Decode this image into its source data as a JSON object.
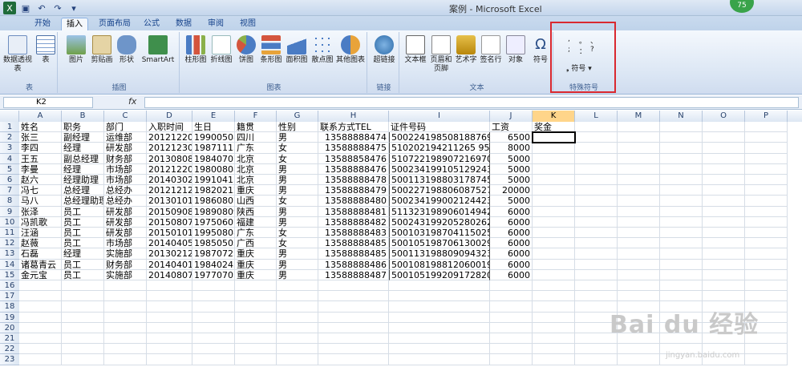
{
  "window": {
    "title": "案例 - Microsoft Excel",
    "badge": "75"
  },
  "qat": {
    "icons": [
      "excel-logo-icon",
      "save-icon",
      "undo-icon",
      "redo-icon",
      "customize-icon"
    ]
  },
  "tabs": [
    "开始",
    "插入",
    "页面布局",
    "公式",
    "数据",
    "审阅",
    "视图"
  ],
  "active_tab": "插入",
  "ribbon": {
    "groups": [
      {
        "label": "表",
        "buttons": [
          "数据透视表",
          "表"
        ]
      },
      {
        "label": "插图",
        "buttons": [
          "图片",
          "剪贴画",
          "形状",
          "SmartArt"
        ]
      },
      {
        "label": "图表",
        "buttons": [
          "柱形图",
          "折线图",
          "饼图",
          "条形图",
          "面积图",
          "散点图",
          "其他图表"
        ]
      },
      {
        "label": "链接",
        "buttons": [
          "超链接"
        ]
      },
      {
        "label": "文本",
        "buttons": [
          "文本框",
          "页眉和页脚",
          "艺术字",
          "签名行",
          "对象",
          "符号"
        ]
      },
      {
        "label": "特殊符号",
        "buttons": [
          "符号"
        ]
      }
    ],
    "special_symbols": [
      ",",
      "。",
      "、",
      ";",
      "：",
      "?"
    ]
  },
  "namebox": "K2",
  "fx_label": "fx",
  "columns": [
    "A",
    "B",
    "C",
    "D",
    "E",
    "F",
    "G",
    "H",
    "I",
    "J",
    "K",
    "L",
    "M",
    "N",
    "O",
    "P"
  ],
  "selected_column": "K",
  "rows": [
    [
      "姓名",
      "职务",
      "部门",
      "入职时间",
      "生日",
      "籍贯",
      "性别",
      "联系方式TEL",
      "证件号码",
      "工资",
      "奖金"
    ],
    [
      "张三",
      "副经理",
      "运维部",
      "20121220",
      "19900508",
      "四川",
      "男",
      "13588888474",
      "500224198508188769",
      "6500",
      ""
    ],
    [
      "李四",
      "经理",
      "研发部",
      "20121230",
      "19871115",
      "广东",
      "女",
      "13588888475",
      "510202194211265 95X",
      "8000",
      ""
    ],
    [
      "王五",
      "副总经理",
      "财务部",
      "20130808",
      "19840707",
      "北京",
      "女",
      "13588858476",
      "510722198907216970",
      "5000",
      ""
    ],
    [
      "李曼",
      "经理",
      "市场部",
      "20121220",
      "19800808",
      "北京",
      "男",
      "13588888476",
      "500234199105129243",
      "5000",
      ""
    ],
    [
      "赵六",
      "经理助理",
      "市场部",
      "20140302",
      "19910415",
      "北京",
      "男",
      "13588888478",
      "500113198803178745",
      "5000",
      ""
    ],
    [
      "冯七",
      "总经理",
      "总经办",
      "20121212",
      "19820212",
      "重庆",
      "男",
      "13588888479",
      "500227198806087527",
      "20000",
      ""
    ],
    [
      "马八",
      "总经理助理",
      "总经办",
      "20130101",
      "19860807",
      "山西",
      "女",
      "13588888480",
      "500234199002124423",
      "5000",
      ""
    ],
    [
      "张泽",
      "员工",
      "研发部",
      "20150908",
      "19890809",
      "陕西",
      "男",
      "13588888481",
      "511323198906014942",
      "6000",
      ""
    ],
    [
      "冯凯歌",
      "员工",
      "研发部",
      "20150807",
      "19750601",
      "福建",
      "男",
      "13588888482",
      "500243199205280262",
      "6000",
      ""
    ],
    [
      "汪涵",
      "员工",
      "研发部",
      "20150101",
      "19950808",
      "广东",
      "女",
      "13588888483",
      "500103198704115025",
      "6000",
      ""
    ],
    [
      "赵薇",
      "员工",
      "市场部",
      "20140405",
      "19850505",
      "广西",
      "女",
      "13588888485",
      "500105198706130029",
      "6000",
      ""
    ],
    [
      "石磊",
      "经理",
      "实施部",
      "20130212",
      "19870725",
      "重庆",
      "男",
      "13588888485",
      "500113198809094323",
      "6000",
      ""
    ],
    [
      "诸葛青云",
      "员工",
      "财务部",
      "20140401",
      "19840245",
      "重庆",
      "男",
      "13588888486",
      "500108198812060019",
      "6000",
      ""
    ],
    [
      "金元宝",
      "员工",
      "实施部",
      "20140807",
      "19770707",
      "重庆",
      "男",
      "13588888487",
      "500105199209172820",
      "6000",
      ""
    ]
  ],
  "total_rows": 23,
  "watermark": "Bai du 经验",
  "watermark_url": "jingyan.baidu.com"
}
